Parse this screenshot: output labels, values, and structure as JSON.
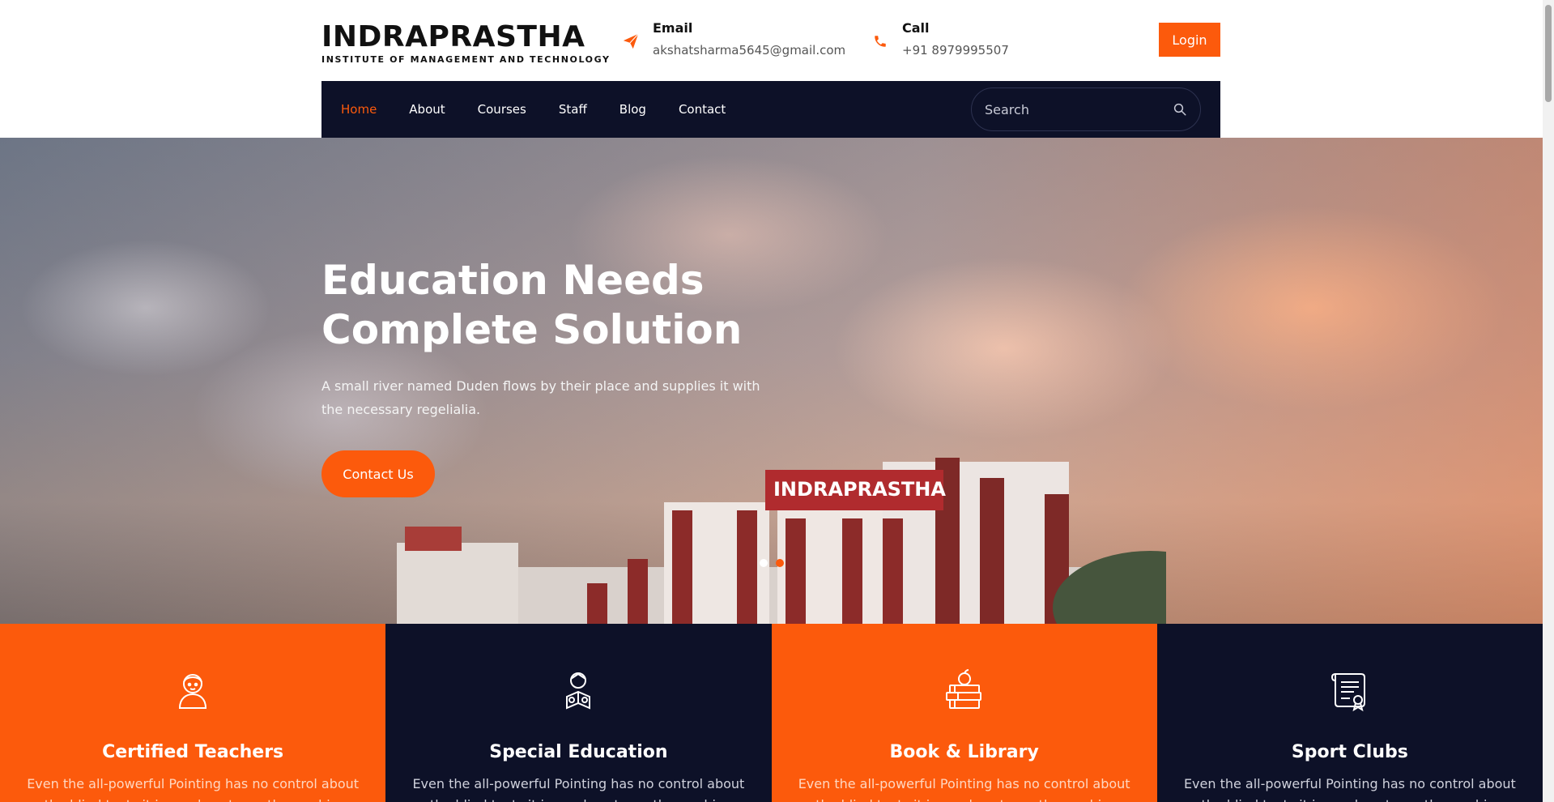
{
  "brand": {
    "title": "INDRAPRASTHA",
    "subtitle": "INSTITUTE OF MANAGEMENT AND TECHNOLOGY"
  },
  "contact": {
    "email_label": "Email",
    "email_value": "akshatsharma5645@gmail.com",
    "email_icon": "paper-plane-icon",
    "call_label": "Call",
    "call_value": "+91 8979995507",
    "call_icon": "phone-icon"
  },
  "login_label": "Login",
  "nav": {
    "items": [
      {
        "label": "Home",
        "active": true
      },
      {
        "label": "About"
      },
      {
        "label": "Courses"
      },
      {
        "label": "Staff"
      },
      {
        "label": "Blog"
      },
      {
        "label": "Contact"
      }
    ],
    "search_placeholder": "Search",
    "search_icon": "search-icon"
  },
  "hero": {
    "title_line1": "Education Needs",
    "title_line2": "Complete Solution",
    "text": "A small river named Duden flows by their place and supplies it with the necessary regelialia.",
    "button_label": "Contact Us",
    "sign_text": "INDRAPRASTHA",
    "slides_total": 2,
    "slide_active": 2
  },
  "features": [
    {
      "title": "Certified Teachers",
      "text": "Even the all-powerful Pointing has no control about the blind texts it is an almost unorthographic.",
      "icon": "teacher-icon",
      "theme": "orange"
    },
    {
      "title": "Special Education",
      "text": "Even the all-powerful Pointing has no control about the blind texts it is an almost unorthographic.",
      "icon": "student-book-icon",
      "theme": "dark"
    },
    {
      "title": "Book & Library",
      "text": "Even the all-powerful Pointing has no control about the blind texts it is an almost unorthographic.",
      "icon": "books-apple-icon",
      "theme": "orange"
    },
    {
      "title": "Sport Clubs",
      "text": "Even the all-powerful Pointing has no control about the blind texts it is an almost unorthographic.",
      "icon": "certificate-scroll-icon",
      "theme": "dark"
    }
  ],
  "colors": {
    "accent": "#fc5a0c",
    "navy": "#0d1128"
  }
}
